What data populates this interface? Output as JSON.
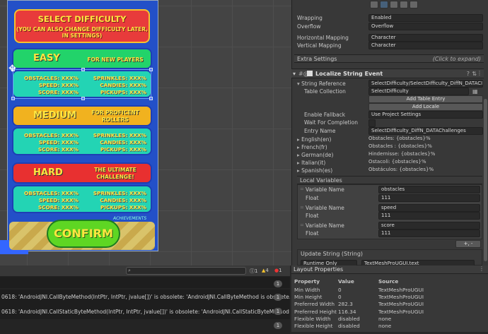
{
  "scene": {
    "title_main": "SELECT DIFFICULTY",
    "title_sub": "(YOU CAN ALSO CHANGE DIFFICULTY LATER, IN SETTINGS)",
    "difficulties": [
      {
        "name": "EASY",
        "desc": "FOR NEW PLAYERS",
        "color": "#22d36a",
        "c1": [
          "OBSTACLES: XXX%",
          "SPEED: XXX%",
          "SCORE: XXX%"
        ],
        "c2": [
          "SPRINKLES: XXX%",
          "CANDIES: XXX%",
          "PICKUPS: XXX%"
        ]
      },
      {
        "name": "MEDIUM",
        "desc": "FOR PROFICENT ROLLERS",
        "color": "#f1b21f",
        "c1": [
          "OBSTACLES: XXX%",
          "SPEED: XXX%",
          "SCORE: XXX%"
        ],
        "c2": [
          "SPRINKLES: XXX%",
          "CANDIES: XXX%",
          "PICKUPS: XXX%"
        ]
      },
      {
        "name": "HARD",
        "desc": "THE ULTIMATE CHALLENGE!",
        "color": "#e83030",
        "c1": [
          "OBSTACLES: XXX%",
          "SPEED: XXX%",
          "SCORE: XXX%"
        ],
        "c2": [
          "SPRINKLES: XXX%",
          "CANDIES: XXX%",
          "PICKUPS: XXX%"
        ]
      }
    ],
    "achievements": "ACHIEVEMENTS",
    "confirm": "CONFIRM"
  },
  "inspector": {
    "wrapping": {
      "label": "Wrapping",
      "value": "Enabled"
    },
    "overflow": {
      "label": "Overflow",
      "value": "Overflow"
    },
    "hmap": {
      "label": "Horizontal Mapping",
      "value": "Character"
    },
    "vmap": {
      "label": "Vertical Mapping",
      "value": "Character"
    },
    "extra": {
      "label": "Extra Settings",
      "hint": "(Click to expand)"
    },
    "component": "Localize String Event",
    "string_ref": {
      "label": "String Reference",
      "value": "SelectDifficulty/SelectDifficulty_DiffN_DATACI"
    },
    "table_collection": {
      "label": "Table Collection",
      "value": "SelectDifficulty"
    },
    "add_table_entry": "Add Table Entry",
    "add_locale": "Add Locale",
    "enable_fallback": {
      "label": "Enable Fallback",
      "value": "Use Project Settings"
    },
    "wait": {
      "label": "Wait For Completion"
    },
    "entry_name": {
      "label": "Entry Name",
      "value": "SelectDifficulty_DiffN_DATAChallenges"
    },
    "locales": [
      {
        "label": "English(en)",
        "value": "Obstacles: {obstacles}%"
      },
      {
        "label": "French(fr)",
        "value": "Obstacles : {obstacles}%"
      },
      {
        "label": "German(de)",
        "value": "Hindernisse: {obstacles}%"
      },
      {
        "label": "Italian(it)",
        "value": "Ostacoli: {obstacles}%"
      },
      {
        "label": "Spanish(es)",
        "value": "Obstáculos: {obstacles}%"
      }
    ],
    "local_vars": "Local Variables",
    "variables": [
      {
        "name_label": "Variable Name",
        "name": "obstacles",
        "type": "Float",
        "value": "111"
      },
      {
        "name_label": "Variable Name",
        "name": "speed",
        "type": "Float",
        "value": "111"
      },
      {
        "name_label": "Variable Name",
        "name": "score",
        "type": "Float",
        "value": "111"
      }
    ],
    "plus_minus": "+, -",
    "update_string": "Update String (String)",
    "runtime_only": "Runtime Only",
    "tmp_text": "TextMeshProUGUI.text"
  },
  "console": {
    "counts": {
      "log": "1",
      "warn": "4",
      "err": "1"
    },
    "rows": [
      "0618: 'AndroidJNI.CallByteMethod(IntPtr, IntPtr, jvalue[])' is obsolete: 'AndroidJNI.CallByteMethod is obsolete. Use AndroidJN",
      "0618: 'AndroidJNI.CallStaticByteMethod(IntPtr, IntPtr, jvalue[])' is obsolete: 'AndroidJNI.CallStaticByteMethod is obsolete. Use",
      "",
      "",
      ""
    ],
    "row_count": "1"
  },
  "layout_props": {
    "title": "Layout Properties",
    "headers": [
      "Property",
      "Value",
      "Source"
    ],
    "rows": [
      [
        "Min Width",
        "0",
        "TextMeshProUGUI"
      ],
      [
        "Min Height",
        "0",
        "TextMeshProUGUI"
      ],
      [
        "Preferred Width",
        "282.3",
        "TextMeshProUGUI"
      ],
      [
        "Preferred Height",
        "116.34",
        "TextMeshProUGUI"
      ],
      [
        "Flexible Width",
        "disabled",
        "none"
      ],
      [
        "Flexible Height",
        "disabled",
        "none"
      ]
    ]
  }
}
